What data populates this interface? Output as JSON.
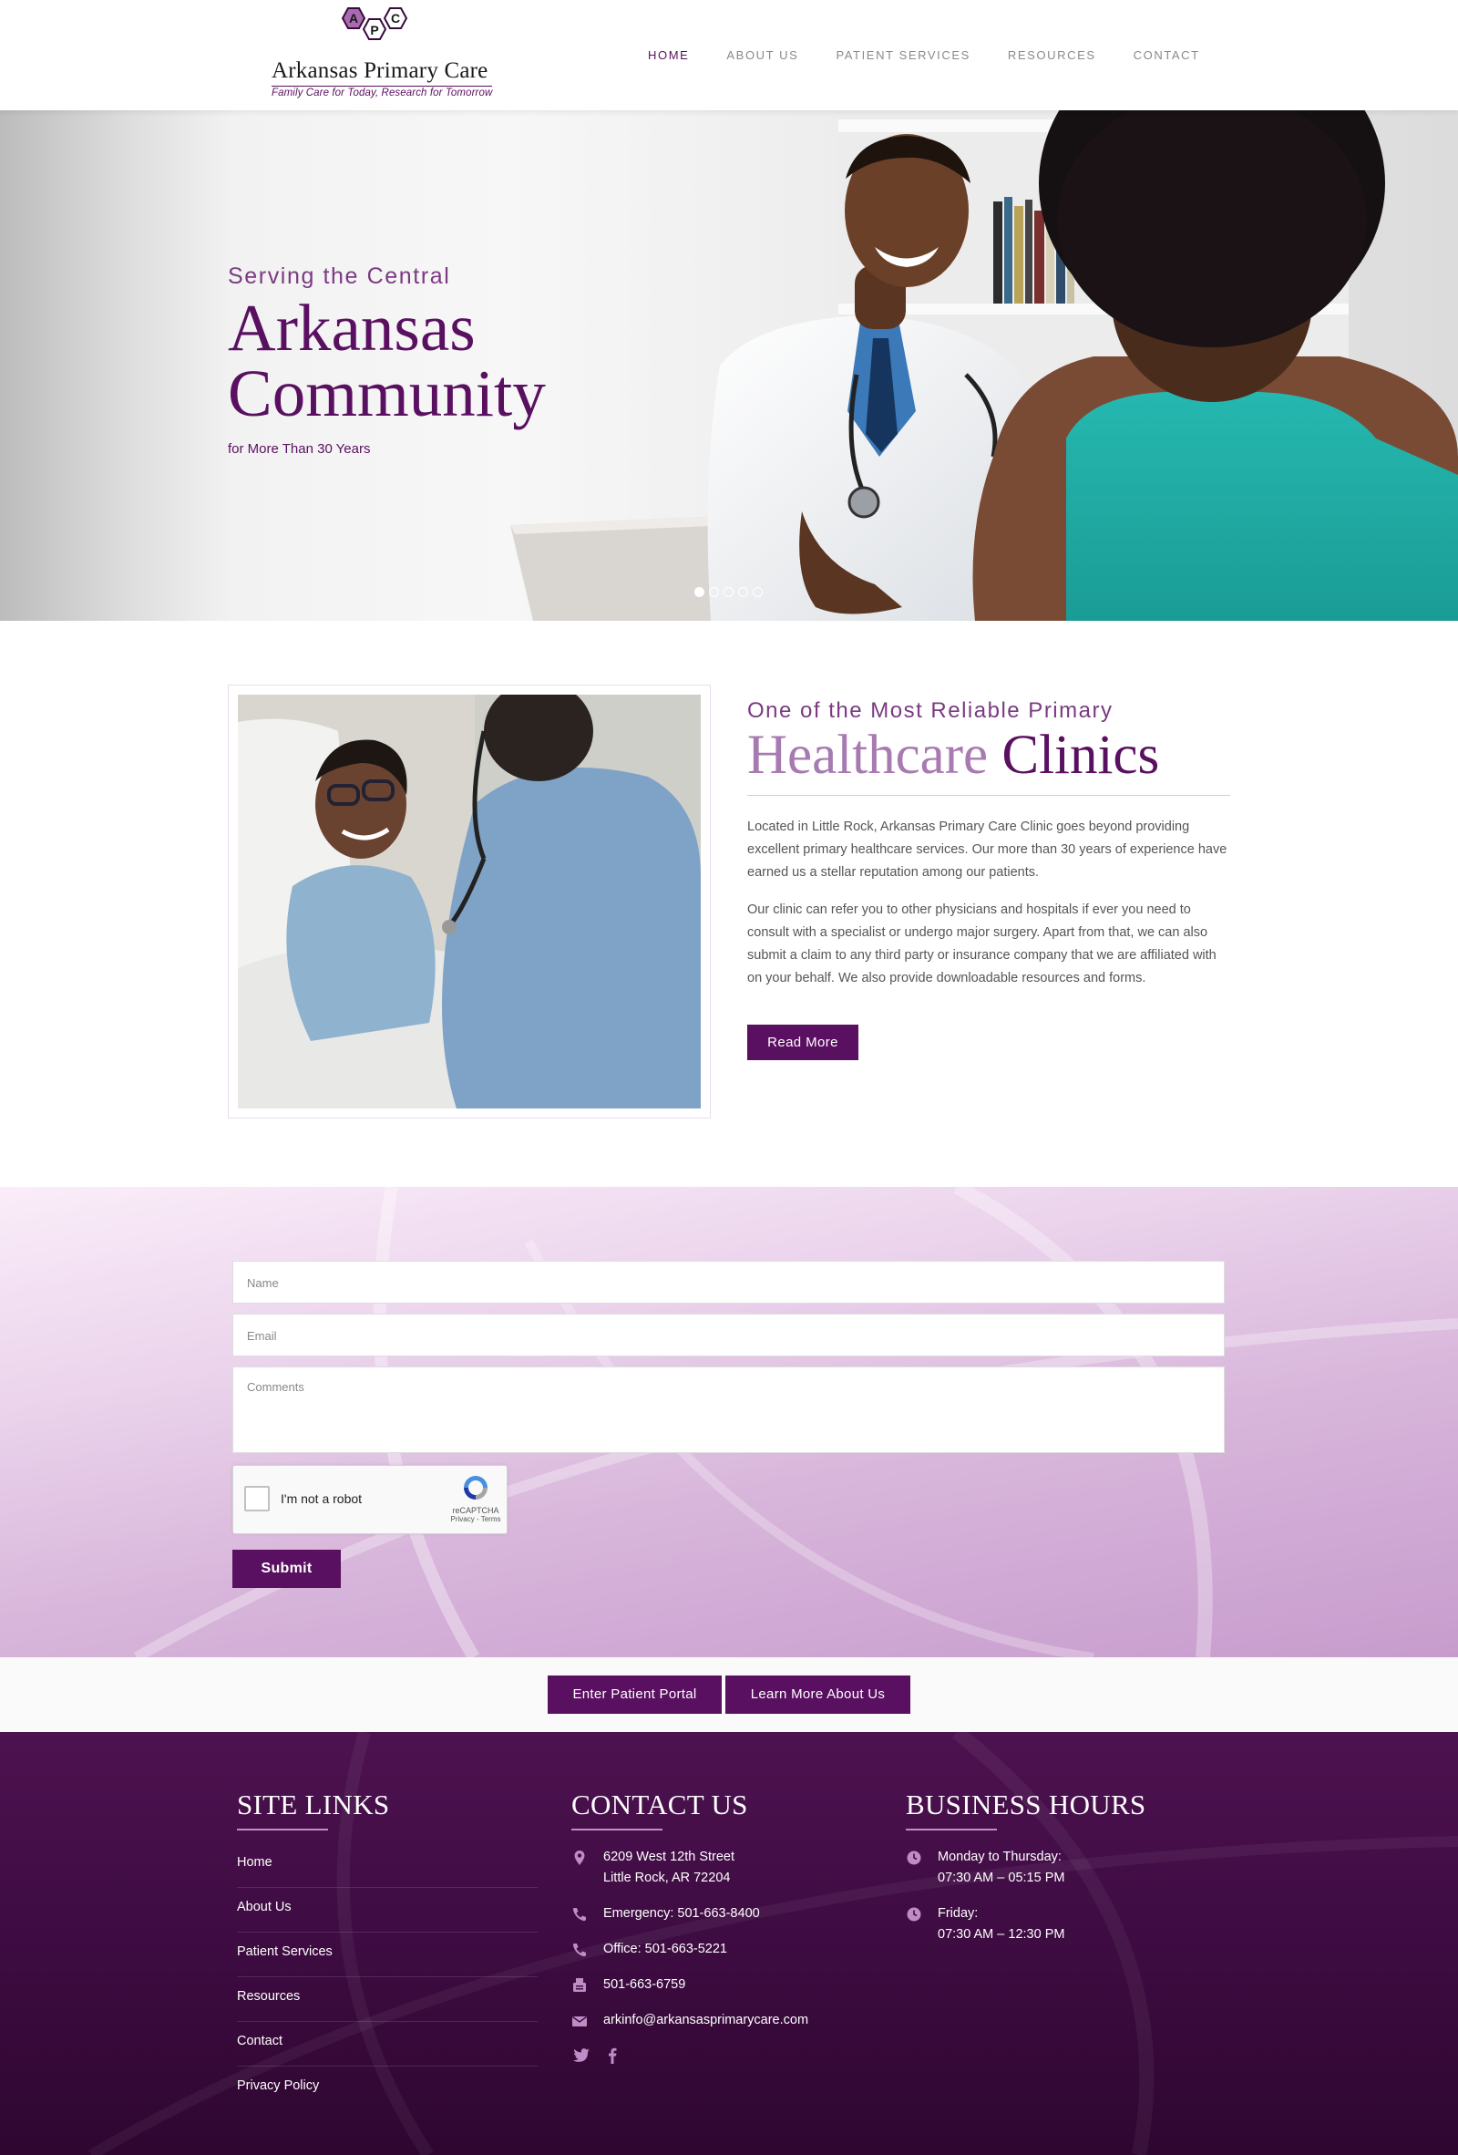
{
  "brand": {
    "name": "Arkansas Primary Care",
    "tagline": "Family Care for Today, Research for Tomorrow",
    "mark_letters": [
      "A",
      "P",
      "C"
    ]
  },
  "nav": {
    "items": [
      {
        "label": "HOME",
        "active": true
      },
      {
        "label": "ABOUT US",
        "active": false
      },
      {
        "label": "PATIENT SERVICES",
        "active": false
      },
      {
        "label": "RESOURCES",
        "active": false
      },
      {
        "label": "CONTACT",
        "active": false
      }
    ]
  },
  "hero": {
    "subtitle": "Serving the Central",
    "title_line1": "Arkansas",
    "title_line2": "Community",
    "footnote": "for More Than 30 Years",
    "slide_count": 5,
    "active_slide": 1
  },
  "about": {
    "subtitle": "One of the Most Reliable Primary",
    "title_light": "Healthcare",
    "title_dark": "Clinics",
    "paragraph1": "Located in Little Rock, Arkansas Primary Care Clinic goes beyond providing excellent primary healthcare services. Our more than 30 years of experience have earned us a stellar reputation among our patients.",
    "paragraph2": "Our clinic can refer you to other physicians and hospitals if ever you need to consult with a specialist or undergo major surgery. Apart from that, we can also submit a claim to any third party or insurance company that we are affiliated with on your behalf. We also provide downloadable resources and forms.",
    "button": "Read More"
  },
  "contact_form": {
    "name_placeholder": "Name",
    "email_placeholder": "Email",
    "comments_placeholder": "Comments",
    "captcha_label": "I'm not a robot",
    "captcha_brand": "reCAPTCHA",
    "captcha_terms": "Privacy - Terms",
    "submit": "Submit"
  },
  "cta": {
    "portal": "Enter Patient Portal",
    "learn_more": "Learn More About Us"
  },
  "footer": {
    "site_links": {
      "heading": "SITE LINKS",
      "items": [
        "Home",
        "About Us",
        "Patient Services",
        "Resources",
        "Contact",
        "Privacy Policy"
      ]
    },
    "contact": {
      "heading": "CONTACT US",
      "address_line1": "6209 West 12th Street",
      "address_line2": "Little Rock, AR 72204",
      "emergency": "Emergency: 501-663-8400",
      "office": "Office: 501-663-5221",
      "fax": "501-663-6759",
      "email": "arkinfo@arkansasprimarycare.com"
    },
    "hours": {
      "heading": "BUSINESS HOURS",
      "items": [
        {
          "days": "Monday to Thursday:",
          "time": "07:30 AM – 05:15 PM"
        },
        {
          "days": "Friday:",
          "time": "07:30 AM – 12:30 PM"
        }
      ]
    }
  },
  "colors": {
    "brand_purple": "#5a1060",
    "accent_purple": "#7b3a82",
    "light_purple": "#a77ab1",
    "footer_bg": "#3f0c43"
  }
}
